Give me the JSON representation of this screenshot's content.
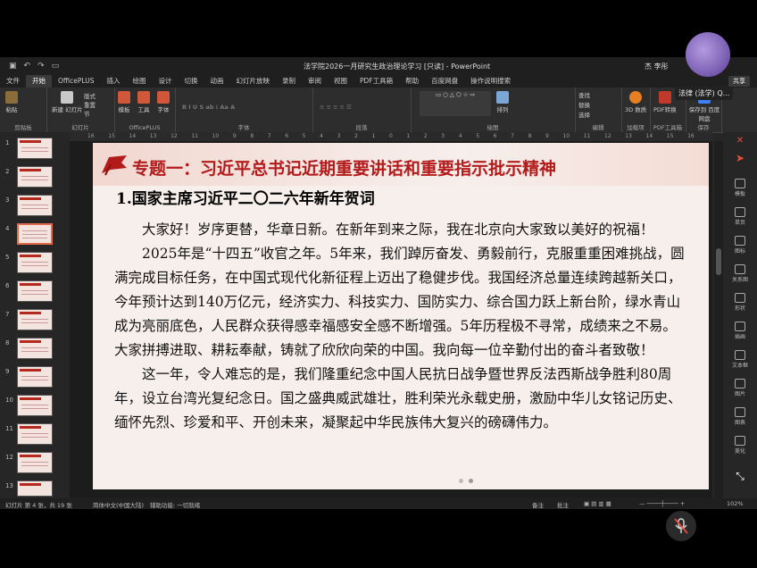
{
  "window": {
    "title": "法学院2026一月研究生政治理论学习 [只读] - PowerPoint",
    "user": "杰 李彤",
    "share_label": "共享"
  },
  "menu": [
    "文件",
    "开始",
    "OfficePLUS",
    "插入",
    "绘图",
    "设计",
    "切换",
    "动画",
    "幻灯片放映",
    "录制",
    "审阅",
    "视图",
    "PDF工具箱",
    "帮助",
    "百度网盘",
    "操作说明搜索"
  ],
  "ribbon": {
    "groups": [
      "剪贴板",
      "幻灯片",
      "OfficePLUS",
      "字体",
      "段落",
      "绘图",
      "编辑",
      "加载项",
      "PDF工具箱",
      "保存"
    ],
    "buttons": {
      "paste": "粘贴",
      "new_slide": "新建\n幻灯片",
      "layout": "版式",
      "reset": "重置",
      "section": "节",
      "template": "模板",
      "tools": "工具",
      "font": "字体",
      "arrange": "排列",
      "find": "查找",
      "replace": "替换",
      "select": "选择",
      "addin": "3D\n数质",
      "pdf": "PDF转换",
      "baidu": "保存到\n百度网盘"
    }
  },
  "ruler": [
    "16",
    "15",
    "14",
    "13",
    "12",
    "11",
    "10",
    "9",
    "8",
    "7",
    "6",
    "5",
    "4",
    "3",
    "2",
    "1",
    "0",
    "1",
    "2",
    "3",
    "4",
    "5",
    "6",
    "7",
    "8",
    "9",
    "10",
    "11",
    "12",
    "13",
    "14",
    "15",
    "16"
  ],
  "thumbnails": [
    "1",
    "2",
    "3",
    "4",
    "5",
    "6",
    "7",
    "8",
    "9",
    "10",
    "11",
    "12",
    "13"
  ],
  "slide": {
    "title": "专题一：习近平总书记近期重要讲话和重要指示批示精神",
    "subtitle": "1.国家主席习近平二〇二六年新年贺词",
    "paragraphs": [
      "大家好！岁序更替，华章日新。在新年到来之际，我在北京向大家致以美好的祝福！",
      "2025年是“十四五”收官之年。5年来，我们踔厉奋发、勇毅前行，克服重重困难挑战，圆满完成目标任务，在中国式现代化新征程上迈出了稳健步伐。我国经济总量连续跨越新关口，今年预计达到140万亿元，经济实力、科技实力、国防实力、综合国力跃上新台阶，绿水青山成为亮丽底色，人民群众获得感幸福感安全感不断增强。5年历程极不寻常，成绩来之不易。大家拼搏进取、耕耘奉献，铸就了欣欣向荣的中国。我向每一位辛勤付出的奋斗者致敬！",
      "这一年，令人难忘的是，我们隆重纪念中国人民抗日战争暨世界反法西斯战争胜利80周年，设立台湾光复纪念日。国之盛典威武雄壮，胜利荣光永载史册，激励中华儿女铭记历史、缅怀先烈、珍爱和平、开创未来，凝聚起中华民族伟大复兴的磅礴伟力。"
    ]
  },
  "right_panel": [
    "模板",
    "单页",
    "图标",
    "关系图",
    "形状",
    "插画",
    "文本框",
    "图片",
    "图表",
    "美化"
  ],
  "status": {
    "slide_info": "幻灯片 第 4 张，共 19 张",
    "language": "简体中文(中国大陆)",
    "accessibility": "辅助功能: 一切就绪",
    "notes": "备注",
    "comments": "批注",
    "zoom": "102%"
  },
  "meeting": {
    "participant": "法律 (法学) Q..."
  },
  "colors": {
    "accent": "#c43e1c",
    "slide_title": "#b31b1b"
  }
}
